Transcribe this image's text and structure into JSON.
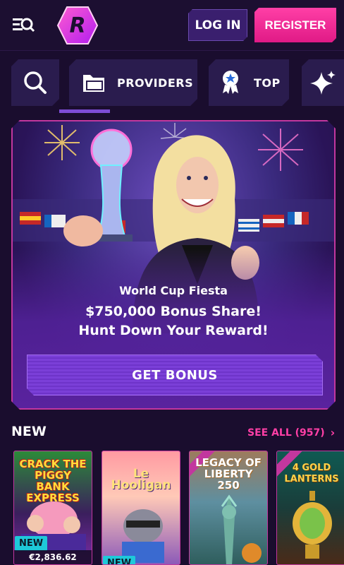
{
  "header": {
    "login_label": "LOG IN",
    "register_label": "REGISTER",
    "logo_letter": "R"
  },
  "tabs": [
    {
      "icon": "search-icon",
      "label": ""
    },
    {
      "icon": "folder-icon",
      "label": "PROVIDERS"
    },
    {
      "icon": "medal-icon",
      "label": "TOP"
    },
    {
      "icon": "sparkle-icon",
      "label": ""
    }
  ],
  "promo": {
    "subtitle": "World Cup Fiesta",
    "line1": "$750,000 Bonus Share!",
    "line2": "Hunt Down Your Reward!",
    "button_label": "GET BONUS"
  },
  "new_section": {
    "title": "NEW",
    "see_all_label": "SEE ALL (957)",
    "games": [
      {
        "title": "CRACK THE PIGGY BANK EXPRESS",
        "badge": "NEW",
        "price": "€2,836.62"
      },
      {
        "title": "Le Hooligan",
        "badge": "NEW",
        "price": ""
      },
      {
        "title": "LEGACY OF LIBERTY 250",
        "badge": "",
        "price": ""
      },
      {
        "title": "4 GOLD LANTERNS",
        "badge": "",
        "price": ""
      }
    ]
  },
  "colors": {
    "background": "#1a0d2e",
    "accent_pink": "#ff3fa6",
    "accent_purple": "#7b3fd8",
    "badge_cyan": "#1ec9d9"
  }
}
